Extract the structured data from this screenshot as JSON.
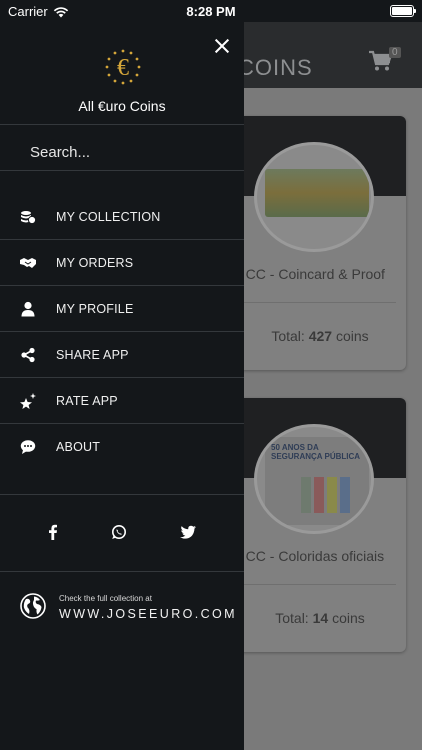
{
  "status_bar": {
    "carrier": "Carrier",
    "time": "8:28 PM"
  },
  "background": {
    "header_title": "COINS",
    "cart_count": "0",
    "cards": [
      {
        "title": "€ CC - Coincard & Proof",
        "total_label": "Total:",
        "total_count": "427",
        "total_unit": "coins"
      },
      {
        "title": "€ CC - Coloridas oficiais",
        "total_label": "Total:",
        "total_count": "14",
        "total_unit": "coins"
      }
    ],
    "coin2_text": "50 ANOS DA SEGURANÇA PÚBLICA"
  },
  "drawer": {
    "app_name": "All €uro Coins",
    "search": {
      "placeholder": "Search...",
      "value": ""
    },
    "menu": [
      {
        "label": "MY COLLECTION",
        "icon": "coins-stack-icon"
      },
      {
        "label": "MY ORDERS",
        "icon": "handshake-icon"
      },
      {
        "label": "MY PROFILE",
        "icon": "user-icon"
      },
      {
        "label": "SHARE APP",
        "icon": "share-icon"
      },
      {
        "label": "RATE APP",
        "icon": "sparkle-star-icon"
      },
      {
        "label": "ABOUT",
        "icon": "chat-bubble-icon"
      }
    ],
    "social": [
      "facebook-icon",
      "whatsapp-icon",
      "twitter-icon"
    ],
    "footer": {
      "caption": "Check the full collection at",
      "link": "WWW.JOSEEURO.COM"
    }
  },
  "colors": {
    "drawer_bg": "#14171a",
    "separator": "#34383c",
    "logo_gold": "#d4a63a"
  }
}
